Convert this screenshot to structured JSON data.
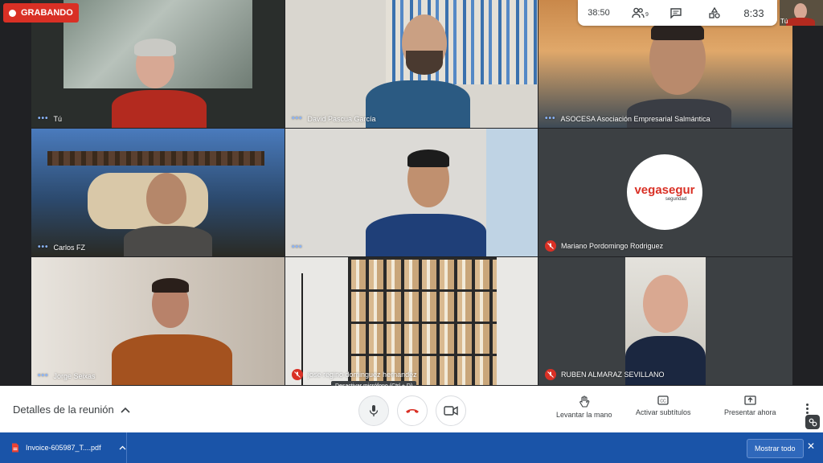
{
  "recording": {
    "label": "GRABANDO"
  },
  "topbar": {
    "elapsed": "38:50",
    "participants_badge": "9",
    "clock": "8:33",
    "self_label": "Tú"
  },
  "tiles": [
    {
      "name": "Tú",
      "muted": false
    },
    {
      "name": "David Pascua García",
      "muted": false
    },
    {
      "name": "ASOCESA Asociación Empresarial Salmántica",
      "muted": false
    },
    {
      "name": "Carlos FZ",
      "muted": false
    },
    {
      "name": "",
      "muted": false
    },
    {
      "name": "Mariano Pordomingo Rodriguez",
      "muted": true
    },
    {
      "name": "Jorge Seixas",
      "muted": false
    },
    {
      "name": "jose regino dominguez hernandez",
      "muted": true
    },
    {
      "name": "RUBEN ALMARAZ SEVILLANO",
      "muted": true
    }
  ],
  "logo": {
    "main": "vegasegur",
    "sub": "seguridad"
  },
  "bottom": {
    "details": "Detalles de la reunión",
    "tooltip": "Desactivar micrófono (Ctrl + D)",
    "raise_hand": "Levantar la mano",
    "captions": "Activar subtítulos",
    "present": "Presentar ahora"
  },
  "downloads": {
    "file": "Invoice-605987_T....pdf",
    "show_all": "Mostrar todo"
  },
  "colors": {
    "red": "#d93025",
    "download_bar": "#1a54a8",
    "accent_blue": "#8ab4f8"
  }
}
